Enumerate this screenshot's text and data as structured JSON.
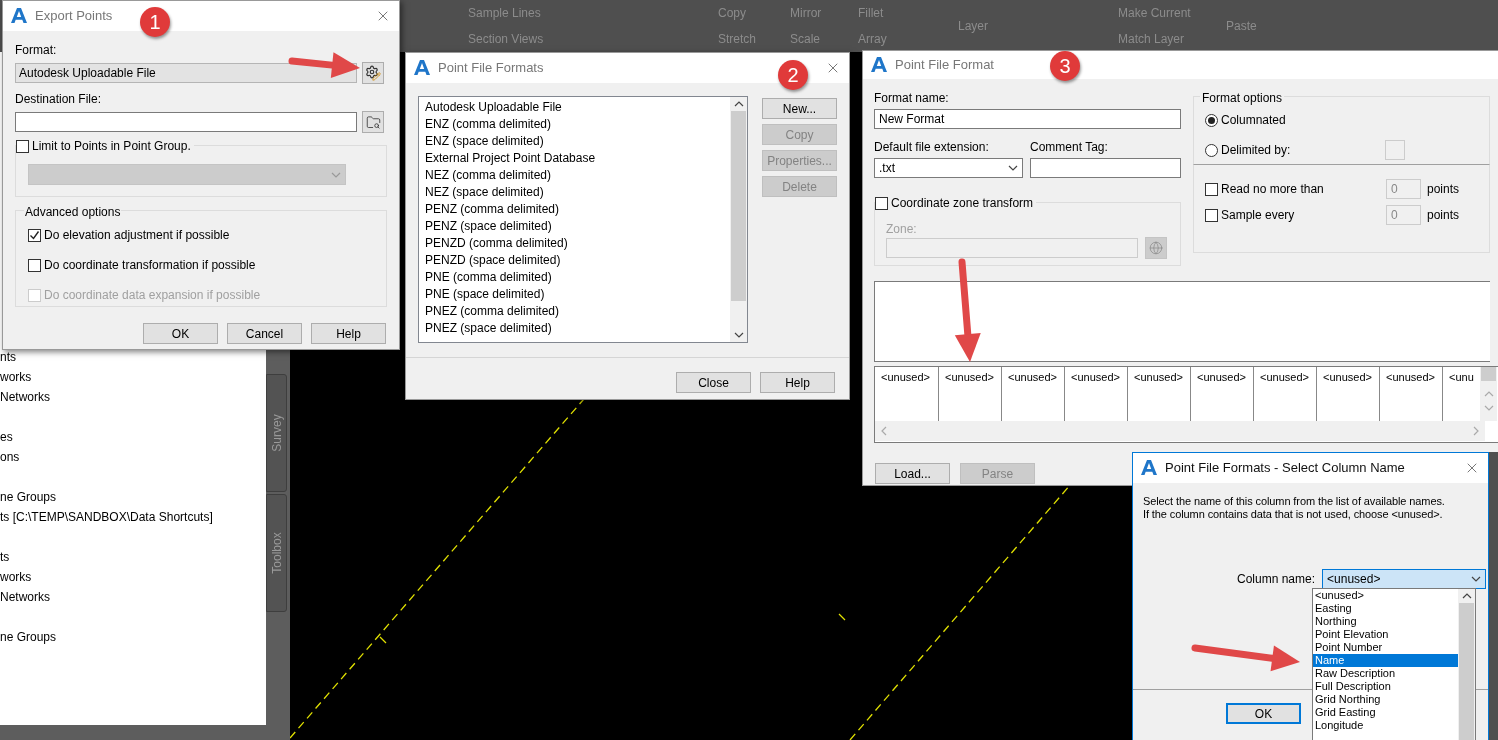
{
  "ribbon": {
    "columns": [
      {
        "top": "Sample Lines",
        "bottom": "Section Views"
      },
      {
        "top": "Copy",
        "bottom": "Stretch"
      },
      {
        "top": "Mirror",
        "bottom": "Scale"
      },
      {
        "top": "Fillet",
        "bottom": "Array"
      },
      {
        "top": "Layer"
      },
      {
        "top": "Make Current",
        "bottom": "Match Layer"
      },
      {
        "top": "Paste"
      }
    ]
  },
  "sidebar": {
    "items": [
      "nts",
      "works",
      "Networks",
      "es",
      "ons",
      "ne Groups",
      "ts [C:\\TEMP\\SANDBOX\\Data Shortcuts]",
      "ts",
      "works",
      "Networks",
      "ne Groups"
    ],
    "tabs": [
      "Survey",
      "Toolbox"
    ]
  },
  "export_points": {
    "title": "Export Points",
    "format_label": "Format:",
    "format_value": "Autodesk Uploadable File",
    "destination_label": "Destination File:",
    "limit": {
      "label": "Limit to Points in Point Group.",
      "checked": false
    },
    "advanced_title": "Advanced options",
    "options": [
      {
        "label": "Do elevation adjustment if possible",
        "checked": true,
        "disabled": false
      },
      {
        "label": "Do coordinate transformation if possible",
        "checked": false,
        "disabled": false
      },
      {
        "label": "Do coordinate data expansion if possible",
        "checked": false,
        "disabled": true
      }
    ],
    "buttons": [
      "OK",
      "Cancel",
      "Help"
    ]
  },
  "point_file_formats": {
    "title": "Point File Formats",
    "items": [
      {
        "label": "Autodesk Uploadable File",
        "selected": false
      },
      {
        "label": "ENZ (comma delimited)",
        "selected": false
      },
      {
        "label": "ENZ (space delimited)",
        "selected": false
      },
      {
        "label": "External Project Point Database",
        "selected": false
      },
      {
        "label": "NEZ (comma delimited)",
        "selected": false
      },
      {
        "label": "NEZ (space delimited)",
        "selected": false
      },
      {
        "label": "PENZ (comma delimited)",
        "selected": false
      },
      {
        "label": "PENZ (space delimited)",
        "selected": false
      },
      {
        "label": "PENZD (comma delimited)",
        "selected": false
      },
      {
        "label": "PENZD (space delimited)",
        "selected": false
      },
      {
        "label": "PNE (comma delimited)",
        "selected": false
      },
      {
        "label": "PNE (space delimited)",
        "selected": false
      },
      {
        "label": "PNEZ (comma delimited)",
        "selected": false
      },
      {
        "label": "PNEZ (space delimited)",
        "selected": false
      }
    ],
    "side_buttons": [
      {
        "label": "New...",
        "disabled": false
      },
      {
        "label": "Copy",
        "disabled": true
      },
      {
        "label": "Properties...",
        "disabled": true
      },
      {
        "label": "Delete",
        "disabled": true
      }
    ],
    "buttons": [
      "Close",
      "Help"
    ]
  },
  "point_file_format": {
    "title": "Point File Format",
    "format_name_label": "Format name:",
    "format_name": "New Format",
    "extension_label": "Default file extension:",
    "extension": ".txt",
    "comment_label": "Comment Tag:",
    "zone_transform": {
      "label": "Coordinate zone transform",
      "checked": false
    },
    "zone_label": "Zone:",
    "format_options_title": "Format options",
    "radios": [
      {
        "label": "Columnated",
        "selected": true
      },
      {
        "label": "Delimited by:",
        "selected": false
      }
    ],
    "limits": [
      {
        "label": "Read no more than",
        "checked": false,
        "value": "0",
        "unit": "points"
      },
      {
        "label": "Sample every",
        "checked": false,
        "value": "0",
        "unit": "points"
      }
    ],
    "columns": [
      "<unused>",
      "<unused>",
      "<unused>",
      "<unused>",
      "<unused>",
      "<unused>",
      "<unused>",
      "<unused>",
      "<unused>",
      "<unu"
    ],
    "buttons": [
      {
        "label": "Load...",
        "disabled": false
      },
      {
        "label": "Parse",
        "disabled": true
      }
    ]
  },
  "select_column": {
    "title": "Point File Formats - Select Column Name",
    "message": "Select the name of this column from the list of available names.\nIf the column contains data that is not used, choose <unused>.",
    "column_label": "Column name:",
    "column_value": "<unused>",
    "options": [
      {
        "label": "<unused>",
        "selected": false
      },
      {
        "label": "Easting",
        "selected": false
      },
      {
        "label": "Northing",
        "selected": false
      },
      {
        "label": "Point Elevation",
        "selected": false
      },
      {
        "label": "Point Number",
        "selected": false
      },
      {
        "label": "Name",
        "selected": true
      },
      {
        "label": "Raw Description",
        "selected": false
      },
      {
        "label": "Full Description",
        "selected": false
      },
      {
        "label": "Grid Northing",
        "selected": false
      },
      {
        "label": "Grid Easting",
        "selected": false
      },
      {
        "label": "Longitude",
        "selected": false
      }
    ],
    "ok": "OK"
  },
  "annotations": [
    "1",
    "2",
    "3"
  ]
}
